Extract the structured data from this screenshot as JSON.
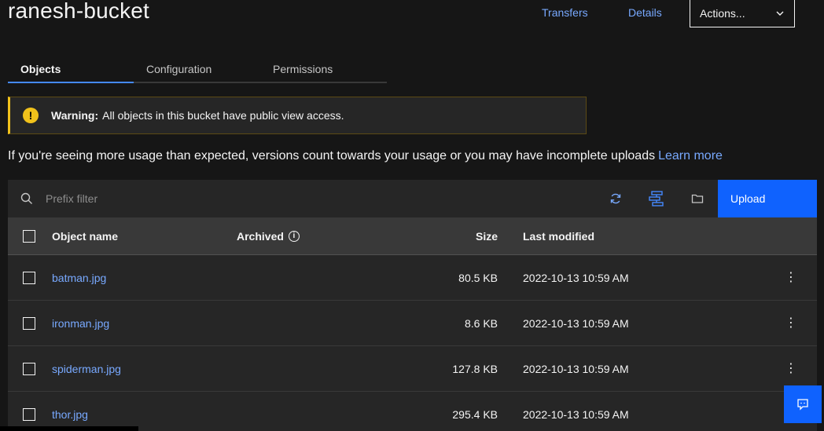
{
  "header": {
    "title": "ranesh-bucket",
    "transfers": "Transfers",
    "details": "Details",
    "actions": "Actions..."
  },
  "tabs": [
    {
      "label": "Objects",
      "active": true
    },
    {
      "label": "Configuration",
      "active": false
    },
    {
      "label": "Permissions",
      "active": false
    }
  ],
  "warning": {
    "label": "Warning:",
    "text": "All objects in this bucket have public view access."
  },
  "usage": {
    "text": "If you're seeing more usage than expected, versions count towards your usage or you may have incomplete uploads",
    "link": "Learn more"
  },
  "toolbar": {
    "search_placeholder": "Prefix filter",
    "upload": "Upload"
  },
  "table": {
    "headers": {
      "name": "Object name",
      "archived": "Archived",
      "size": "Size",
      "modified": "Last modified"
    },
    "rows": [
      {
        "name": "batman.jpg",
        "size": "80.5 KB",
        "modified": "2022-10-13 10:59 AM"
      },
      {
        "name": "ironman.jpg",
        "size": "8.6 KB",
        "modified": "2022-10-13 10:59 AM"
      },
      {
        "name": "spiderman.jpg",
        "size": "127.8 KB",
        "modified": "2022-10-13 10:59 AM"
      },
      {
        "name": "thor.jpg",
        "size": "295.4 KB",
        "modified": "2022-10-13 10:59 AM"
      }
    ]
  },
  "colors": {
    "accent": "#0f62fe",
    "link": "#78a9ff",
    "warning": "#f1c21b"
  }
}
